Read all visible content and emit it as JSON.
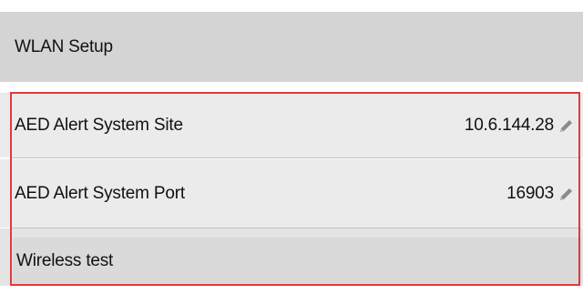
{
  "header": {
    "title": "WLAN Setup"
  },
  "settings": {
    "site": {
      "label": "AED Alert System Site",
      "value": "10.6.144.28",
      "edit_icon": "pencil-icon"
    },
    "port": {
      "label": "AED Alert System Port",
      "value": "16903",
      "edit_icon": "pencil-icon"
    },
    "test": {
      "label": "Wireless test"
    }
  },
  "colors": {
    "header_bg": "#d4d4d4",
    "row_bg": "#ebebeb",
    "highlight_border": "#e23a3a",
    "icon": "#8a8a8a"
  }
}
